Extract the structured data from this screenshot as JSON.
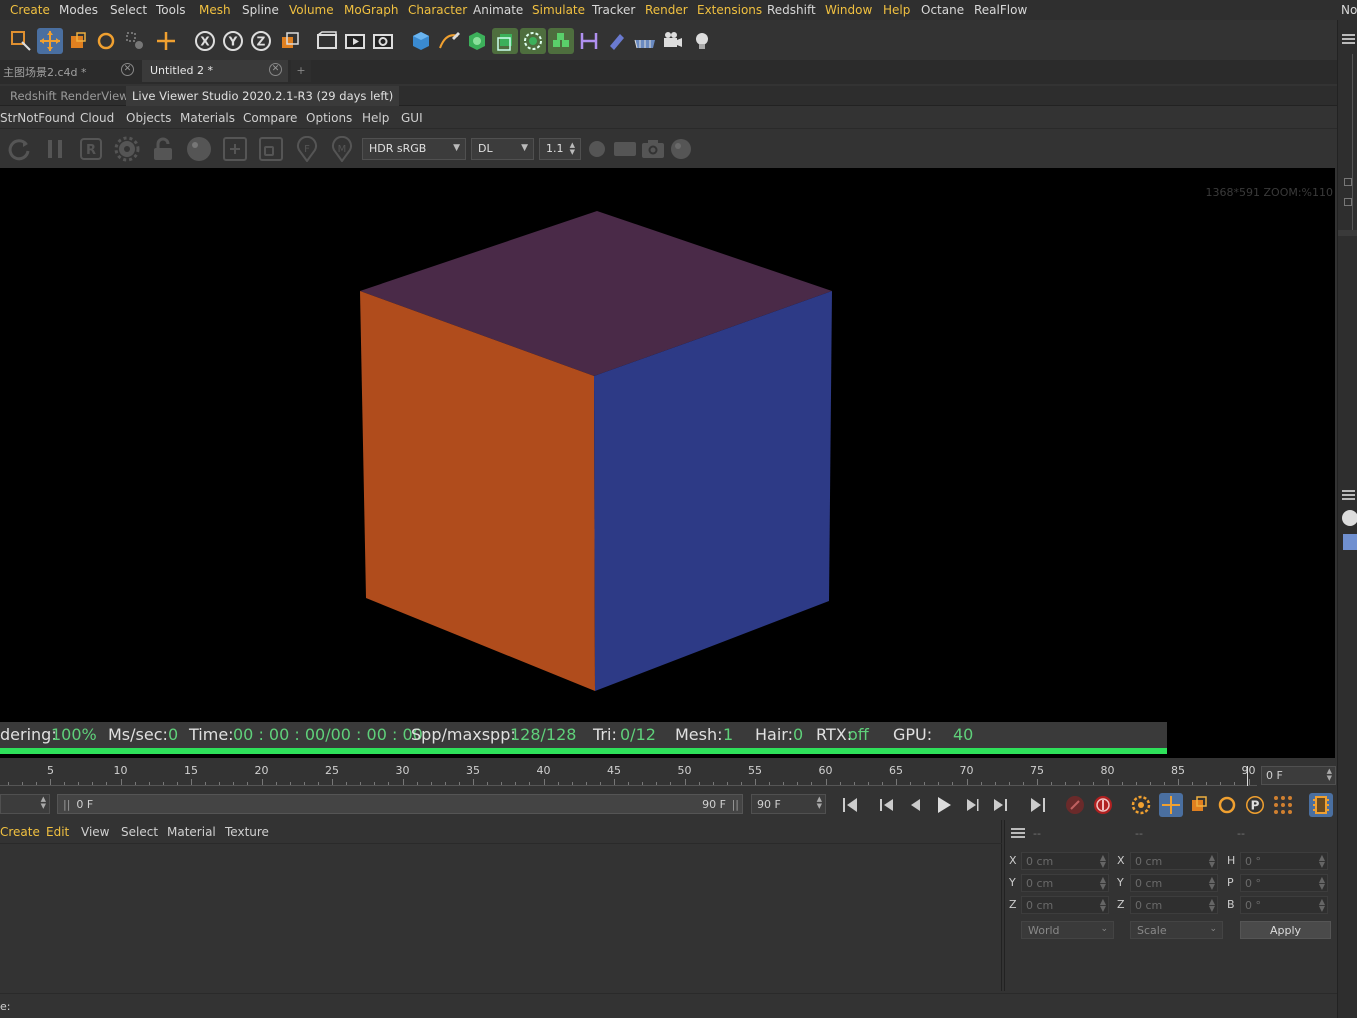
{
  "menubar": {
    "items": [
      {
        "label": "Create",
        "accent": true
      },
      {
        "label": "Modes",
        "accent": false
      },
      {
        "label": "Select",
        "accent": false
      },
      {
        "label": "Tools",
        "accent": false
      },
      {
        "label": "Mesh",
        "accent": true
      },
      {
        "label": "Spline",
        "accent": false
      },
      {
        "label": "Volume",
        "accent": true
      },
      {
        "label": "MoGraph",
        "accent": true
      },
      {
        "label": "Character",
        "accent": true
      },
      {
        "label": "Animate",
        "accent": false
      },
      {
        "label": "Simulate",
        "accent": true
      },
      {
        "label": "Tracker",
        "accent": false
      },
      {
        "label": "Render",
        "accent": true
      },
      {
        "label": "Extensions",
        "accent": true
      },
      {
        "label": "Redshift",
        "accent": false
      },
      {
        "label": "Window",
        "accent": true
      },
      {
        "label": "Help",
        "accent": true
      },
      {
        "label": "Octane",
        "accent": false
      },
      {
        "label": "RealFlow",
        "accent": false
      }
    ],
    "right_label": "No"
  },
  "colors": {
    "accent_menu": "#f0c040",
    "green": "#5fd07a",
    "progress": "#2ee05a",
    "cube_top": "#4a2a48",
    "cube_left": "#b04c1c",
    "cube_right": "#2d3a86"
  },
  "doc_tabs": [
    {
      "label": "主图场景2.c4d *",
      "active": false
    },
    {
      "label": "Untitled 2 *",
      "active": true
    }
  ],
  "doc_tab_add": "+",
  "render_view": {
    "tabs": [
      {
        "label": "Redshift RenderView",
        "active": false
      },
      {
        "label": "Live Viewer Studio 2020.2.1-R3 (29 days left)",
        "active": true
      }
    ],
    "menu": [
      "StrNotFound",
      "Cloud",
      "Objects",
      "Materials",
      "Compare",
      "Options",
      "Help",
      "GUI"
    ],
    "color_space": "HDR sRGB",
    "mode": "DL",
    "zoom_value": "1.1",
    "zoom_readout": "1368*591 ZOOM:%110"
  },
  "status_line": {
    "rendering_label": "dering:",
    "rendering_value": "100%",
    "mssec_label": "Ms/sec:",
    "mssec_value": "0",
    "time_label": "Time:",
    "time_value": "00 : 00 : 00/00 : 00 : 00",
    "spp_label": "Spp/maxspp:",
    "spp_value": "128/128",
    "tri_label": "Tri:",
    "tri_value": "0/12",
    "mesh_label": "Mesh:",
    "mesh_value": "1",
    "hair_label": "Hair:",
    "hair_value": "0",
    "rtx_label": "RTX:",
    "rtx_value": "off",
    "gpu_label": "GPU:",
    "gpu_value": "40",
    "progress": 1.0
  },
  "timeline": {
    "ticks": [
      "5",
      "10",
      "15",
      "20",
      "25",
      "30",
      "35",
      "40",
      "45",
      "50",
      "55",
      "60",
      "65",
      "70",
      "75",
      "80",
      "85",
      "90"
    ],
    "current_frame": "0 F"
  },
  "anim": {
    "range_start": "0 F",
    "range_end": "90 F",
    "end_frame": "90 F"
  },
  "material_manager": {
    "menu": [
      "Create",
      "Edit",
      "View",
      "Select",
      "Material",
      "Texture"
    ]
  },
  "coordinates": {
    "header": [
      "--",
      "--",
      "--"
    ],
    "rows": [
      {
        "l1": "X",
        "v1": "0 cm",
        "l2": "X",
        "v2": "0 cm",
        "l3": "H",
        "v3": "0 °"
      },
      {
        "l1": "Y",
        "v1": "0 cm",
        "l2": "Y",
        "v2": "0 cm",
        "l3": "P",
        "v3": "0 °"
      },
      {
        "l1": "Z",
        "v1": "0 cm",
        "l2": "Z",
        "v2": "0 cm",
        "l3": "B",
        "v3": "0 °"
      }
    ],
    "space": "World",
    "mode": "Scale",
    "apply": "Apply"
  },
  "bottom_status": "e:"
}
